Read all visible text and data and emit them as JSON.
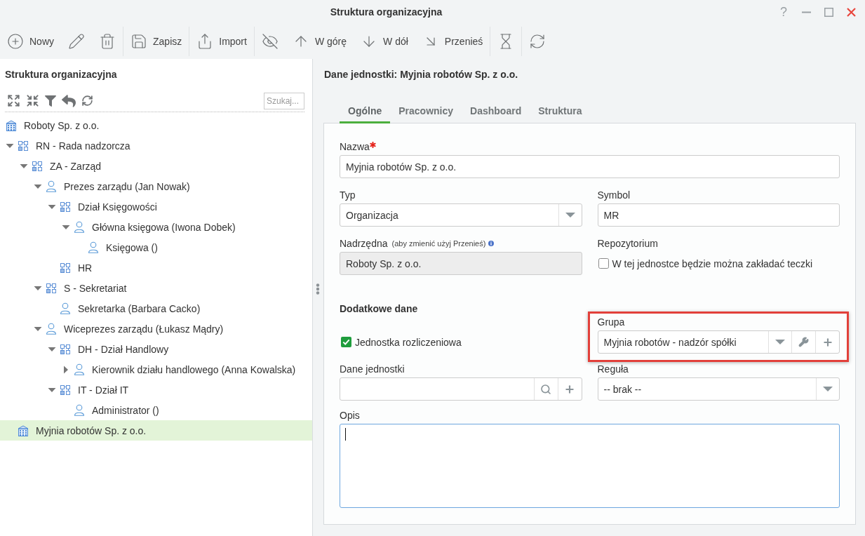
{
  "window": {
    "title": "Struktura organizacyjna",
    "help": "?"
  },
  "toolbar": {
    "groups": [
      {
        "buttons": [
          {
            "kind": "new",
            "label": "Nowy"
          },
          {
            "kind": "edit"
          },
          {
            "kind": "delete"
          }
        ]
      },
      {
        "buttons": [
          {
            "kind": "save",
            "label": "Zapisz"
          }
        ]
      },
      {
        "buttons": [
          {
            "kind": "import",
            "label": "Import"
          }
        ]
      },
      {
        "buttons": [
          {
            "kind": "hide"
          },
          {
            "kind": "up",
            "label": "W górę"
          },
          {
            "kind": "down",
            "label": "W dół"
          },
          {
            "kind": "move",
            "label": "Przenieś"
          }
        ]
      },
      {
        "buttons": [
          {
            "kind": "history"
          }
        ]
      },
      {
        "buttons": [
          {
            "kind": "refresh"
          }
        ]
      }
    ]
  },
  "tree_panel": {
    "title": "Struktura organizacyjna",
    "search": {
      "placeholder": "Szukaj..."
    },
    "items": [
      {
        "label": "Roboty Sp. z o.o.",
        "kind": "organization",
        "selected": false,
        "children": [
          {
            "label": "RN - Rada nadzorcza",
            "kind": "unit",
            "expanded": true,
            "selected": false,
            "children": [
              {
                "label": "ZA - Zarząd",
                "kind": "unit",
                "expanded": true,
                "selected": false,
                "children": [
                  {
                    "label": "Prezes zarządu (Jan Nowak)",
                    "kind": "position",
                    "expanded": true,
                    "selected": false,
                    "children": [
                      {
                        "label": "Dział Księgowości",
                        "kind": "unit",
                        "expanded": true,
                        "selected": false,
                        "children": [
                          {
                            "label": "Główna księgowa (Iwona Dobek)",
                            "kind": "position",
                            "expanded": true,
                            "selected": false,
                            "children": [
                              {
                                "label": "Księgowa ()",
                                "kind": "position",
                                "selected": false
                              }
                            ]
                          }
                        ]
                      },
                      {
                        "label": "HR",
                        "kind": "unit",
                        "selected": false
                      }
                    ]
                  },
                  {
                    "label": "S - Sekretariat",
                    "kind": "unit",
                    "expanded": true,
                    "selected": false,
                    "children": [
                      {
                        "label": "Sekretarka (Barbara Cacko)",
                        "kind": "position",
                        "selected": false
                      }
                    ]
                  },
                  {
                    "label": "Wiceprezes zarządu (Łukasz Mądry)",
                    "kind": "position",
                    "expanded": true,
                    "selected": false,
                    "children": [
                      {
                        "label": "DH - Dział Handlowy",
                        "kind": "unit",
                        "expanded": true,
                        "selected": false,
                        "children": [
                          {
                            "label": "Kierownik działu handlowego (Anna Kowalska)",
                            "kind": "position",
                            "expanded": false,
                            "selected": false
                          }
                        ]
                      },
                      {
                        "label": "IT - Dział IT",
                        "kind": "unit",
                        "expanded": true,
                        "selected": false,
                        "children": [
                          {
                            "label": "Administrator ()",
                            "kind": "position",
                            "selected": false
                          }
                        ]
                      }
                    ]
                  }
                ]
              }
            ]
          },
          {
            "label": "Myjnia robotów Sp. z o.o.",
            "kind": "organization",
            "selected": true
          }
        ]
      }
    ]
  },
  "details": {
    "title": "Dane jednostki: Myjnia robotów Sp. z o.o.",
    "tabs": [
      {
        "label": "Ogólne",
        "selected": true
      },
      {
        "label": "Pracownicy",
        "selected": false
      },
      {
        "label": "Dashboard",
        "selected": false
      },
      {
        "label": "Struktura",
        "selected": false
      }
    ],
    "form": {
      "name": {
        "label": "Nazwa",
        "required": true,
        "value": "Myjnia robotów Sp. z o.o."
      },
      "type": {
        "label": "Typ",
        "value": "Organizacja"
      },
      "symbol": {
        "label": "Symbol",
        "value": "MR"
      },
      "parent": {
        "label": "Nadrzędna",
        "hint": "(aby zmienić użyj Przenieś)",
        "value": "Roboty Sp. z o.o.",
        "disabled": true
      },
      "repository": {
        "label": "Repozytorium",
        "option": "W tej jednostce będzie można zakładać teczki",
        "checked": false
      },
      "section_title": "Dodatkowe dane",
      "billing_unit": {
        "label": "Jednostka rozliczeniowa",
        "checked": true
      },
      "group": {
        "label": "Grupa",
        "value": "Myjnia robotów - nadzór spółki",
        "highlighted": true
      },
      "unit_data": {
        "label": "Dane jednostki"
      },
      "rule": {
        "label": "Reguła",
        "value": "-- brak --"
      },
      "description": {
        "label": "Opis",
        "focused": true
      }
    }
  }
}
